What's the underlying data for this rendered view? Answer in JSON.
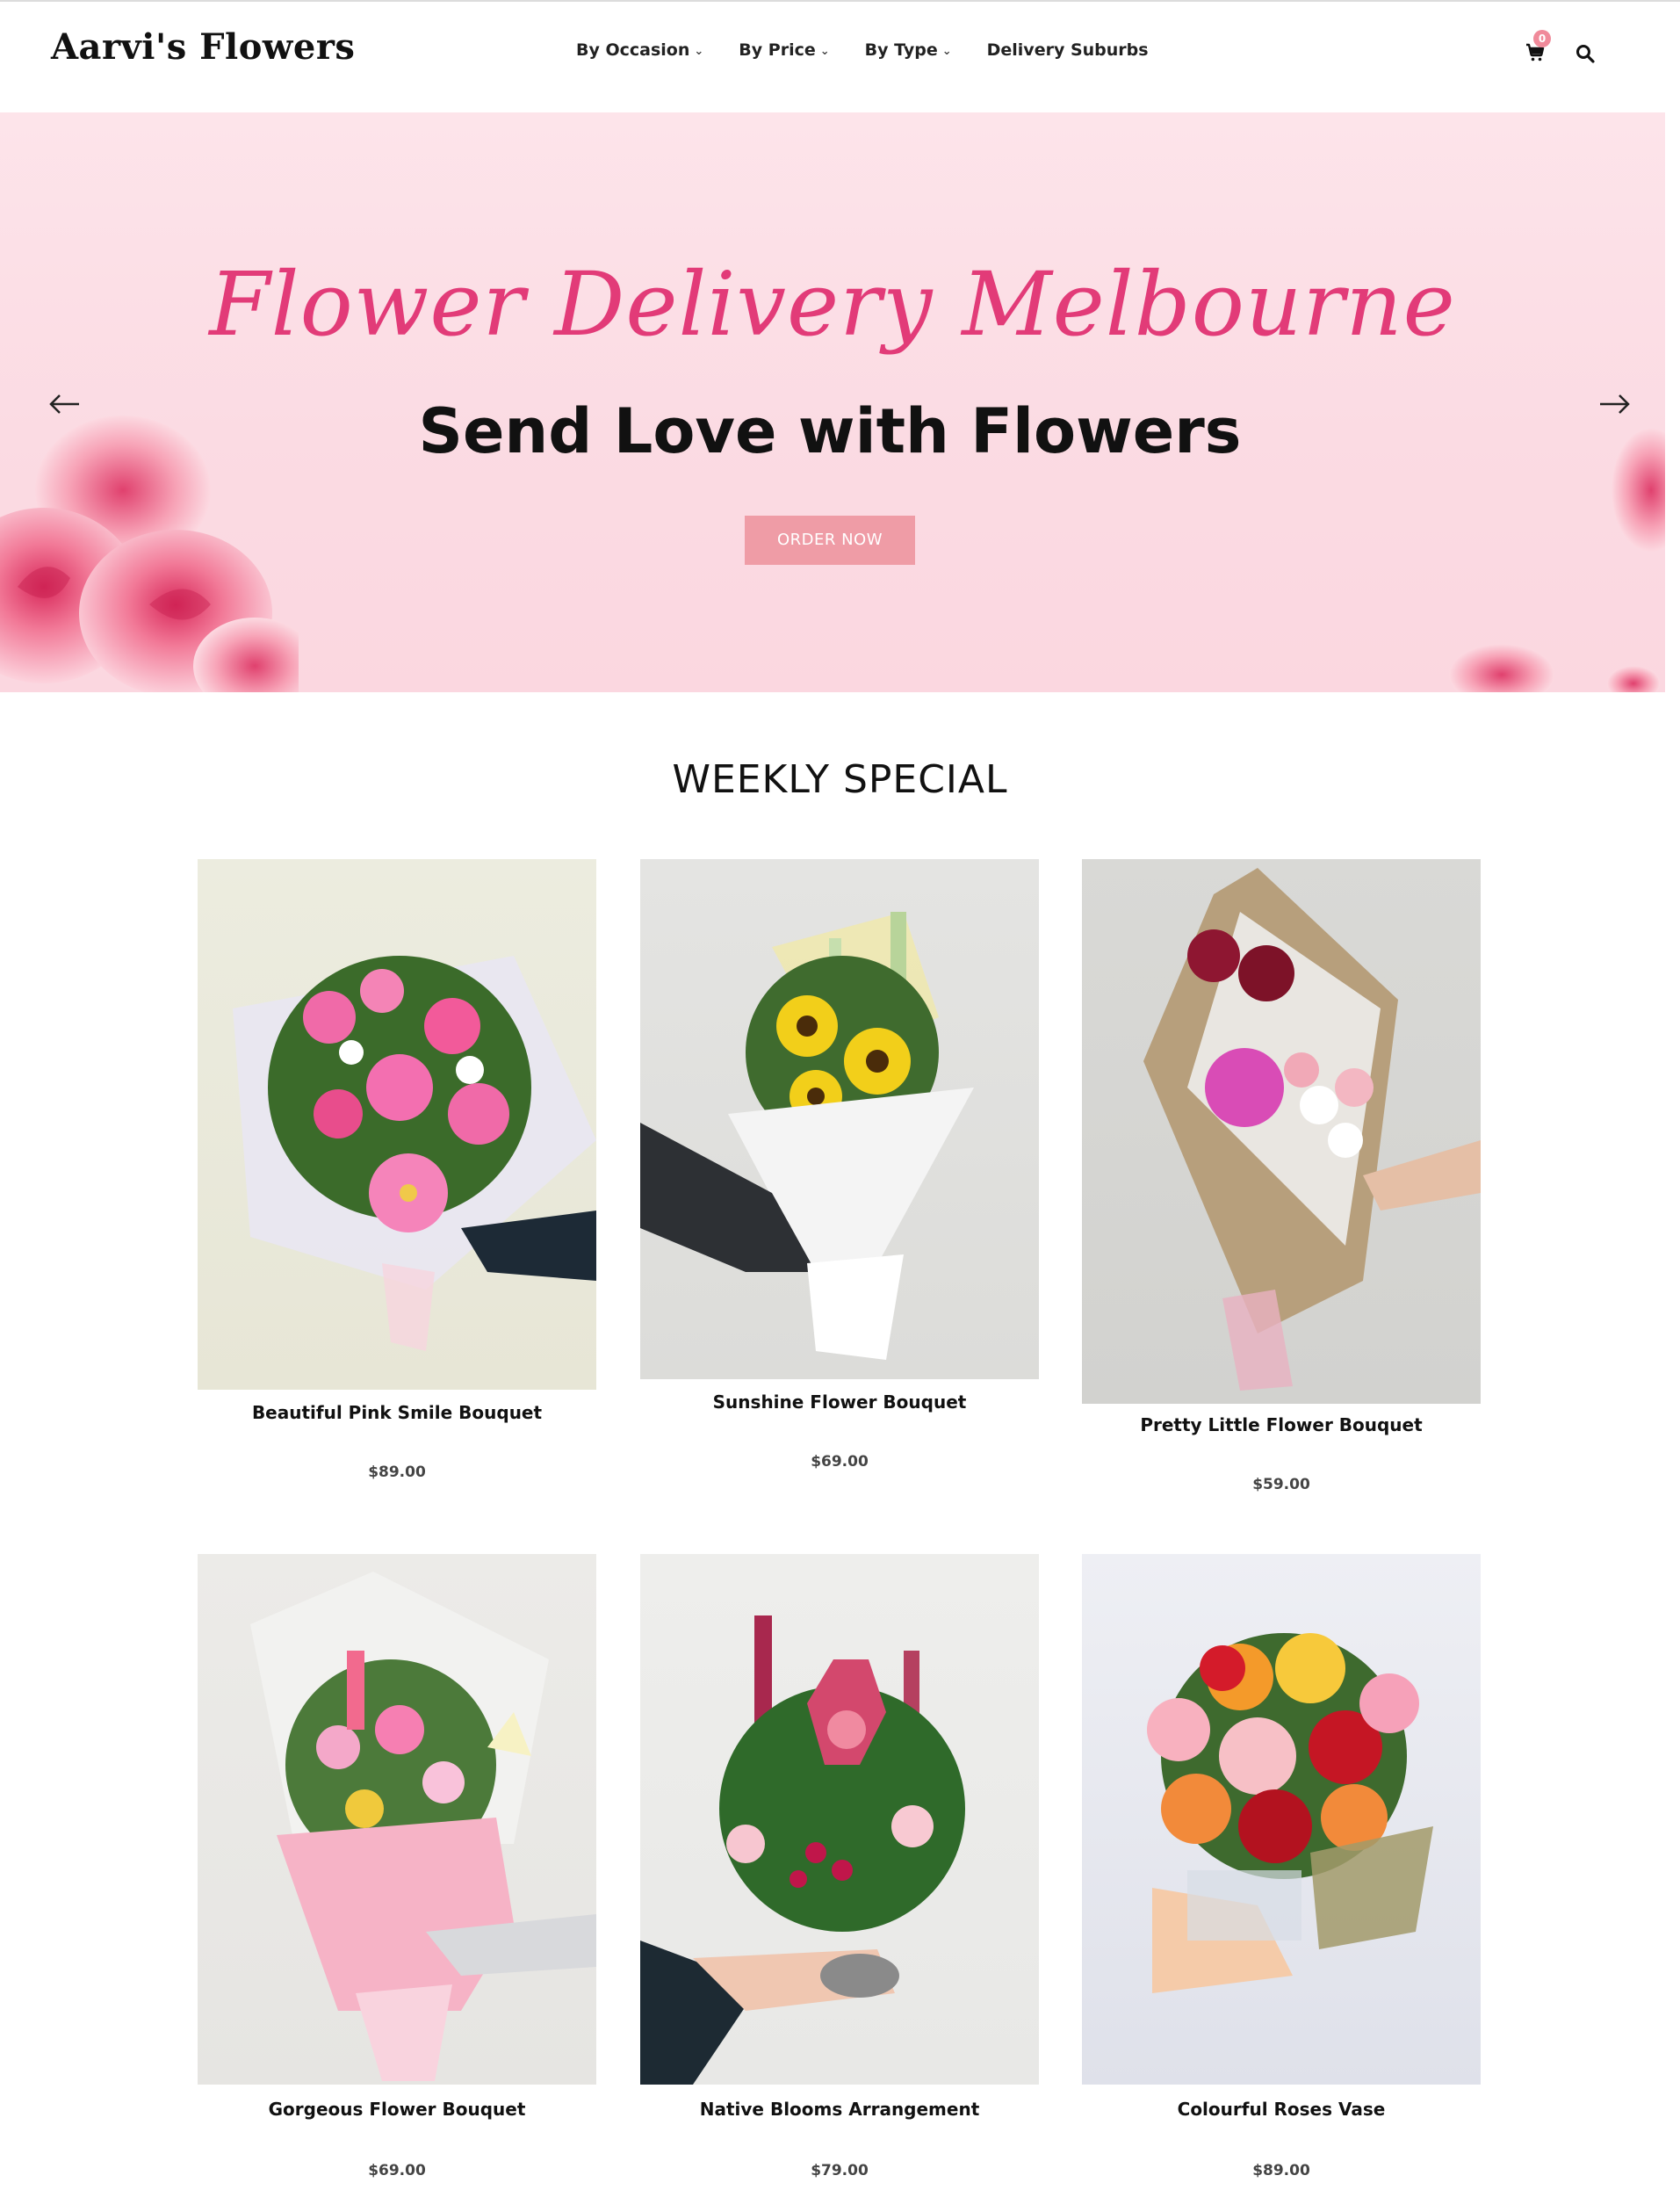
{
  "header": {
    "logo": "Aarvi's Flowers",
    "nav": [
      {
        "label": "By Occasion",
        "has_dropdown": true
      },
      {
        "label": "By Price",
        "has_dropdown": true
      },
      {
        "label": "By Type",
        "has_dropdown": true
      },
      {
        "label": "Delivery Suburbs",
        "has_dropdown": false
      }
    ],
    "cart_count": "0",
    "cart_icon": "cart-icon",
    "search_icon": "search-icon"
  },
  "hero": {
    "script_heading": "Flower Delivery Melbourne",
    "heading": "Send Love with Flowers",
    "button": "ORDER NOW",
    "prev_icon": "arrow-left-icon",
    "next_icon": "arrow-right-icon"
  },
  "weekly": {
    "title": "WEEKLY SPECIAL",
    "products": [
      {
        "name": "Beautiful Pink Smile Bouquet",
        "price": "$89.00",
        "image": "pink gerbera and rose bouquet"
      },
      {
        "name": "Sunshine Flower Bouquet",
        "price": "$69.00",
        "image": "sunflower bouquet"
      },
      {
        "name": "Pretty Little Flower Bouquet",
        "price": "$59.00",
        "image": "burlap wrapped mixed bouquet"
      },
      {
        "name": "Gorgeous Flower Bouquet",
        "price": "$69.00",
        "image": "pink lily and snapdragon bouquet"
      },
      {
        "name": "Native Blooms Arrangement",
        "price": "$79.00",
        "image": "protea native arrangement"
      },
      {
        "name": "Colourful Roses Vase",
        "price": "$89.00",
        "image": "mixed roses in vase"
      }
    ]
  },
  "colors": {
    "accent": "#e23b78",
    "button": "#ef9ca6",
    "hero_bg": "#fde4ea"
  }
}
